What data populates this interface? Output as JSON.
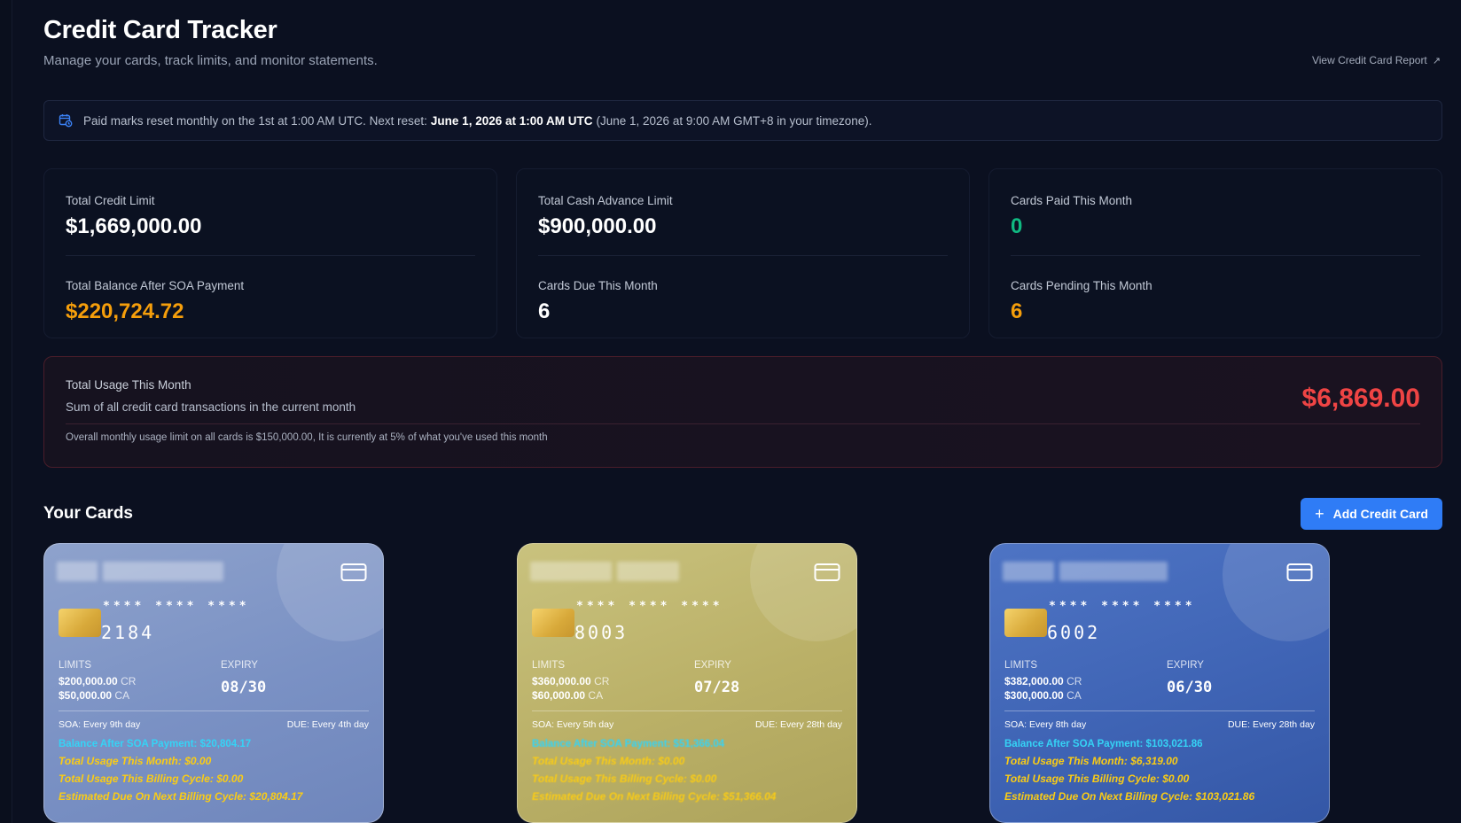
{
  "header": {
    "title": "Credit Card Tracker",
    "subtitle": "Manage your cards, track limits, and monitor statements.",
    "report_link": "View Credit Card Report"
  },
  "notice": {
    "text_before": "Paid marks reset monthly on the 1st at 1:00 AM UTC. Next reset:",
    "next_reset": "June 1, 2026 at 1:00 AM UTC",
    "text_after": "(June 1, 2026 at 9:00 AM GMT+8 in your timezone)."
  },
  "stats": [
    {
      "top_label": "Total Credit Limit",
      "top_value": "$1,669,000.00",
      "bottom_label": "Total Balance After SOA Payment",
      "bottom_value": "$220,724.72"
    },
    {
      "top_label": "Total Cash Advance Limit",
      "top_value": "$900,000.00",
      "bottom_label": "Cards Due This Month",
      "bottom_value": "6"
    },
    {
      "top_label": "Cards Paid This Month",
      "top_value": "0",
      "bottom_label": "Cards Pending This Month",
      "bottom_value": "6"
    }
  ],
  "usage": {
    "title": "Total Usage This Month",
    "description": "Sum of all credit card transactions in the current month",
    "amount": "$6,869.00",
    "note": "Overall monthly usage limit on all cards is $150,000.00, It is currently at 5% of what you've used this month"
  },
  "cards_section": {
    "title": "Your Cards",
    "add_button": "Add Credit Card"
  },
  "colors": {
    "accent": "#2f7cf6",
    "orange": "#f59e0b",
    "green": "#10b981",
    "red": "#ef4444",
    "cyan": "#35d3f5",
    "yellow": "#facc15"
  },
  "cards": [
    {
      "masked": "**** **** ****",
      "last4": "2184",
      "limits_label": "LIMITS",
      "expiry_label": "EXPIRY",
      "credit_limit": "$200,000.00",
      "cash_limit": "$50,000.00",
      "cr_unit": "CR",
      "ca_unit": "CA",
      "expiry": "08/30",
      "soa": "SOA: Every 9th day",
      "due": "DUE: Every 4th day",
      "balance_after_soa": "Balance After SOA Payment: $20,804.17",
      "usage_month": "Total Usage This Month: $0.00",
      "usage_cycle": "Total Usage This Billing Cycle: $0.00",
      "estimated_due": "Estimated Due On Next Billing Cycle: $20,804.17"
    },
    {
      "masked": "**** **** ****",
      "last4": "8003",
      "limits_label": "LIMITS",
      "expiry_label": "EXPIRY",
      "credit_limit": "$360,000.00",
      "cash_limit": "$60,000.00",
      "cr_unit": "CR",
      "ca_unit": "CA",
      "expiry": "07/28",
      "soa": "SOA: Every 5th day",
      "due": "DUE: Every 28th day",
      "balance_after_soa": "Balance After SOA Payment: $51,366.04",
      "usage_month": "Total Usage This Month: $0.00",
      "usage_cycle": "Total Usage This Billing Cycle: $0.00",
      "estimated_due": "Estimated Due On Next Billing Cycle: $51,366.04"
    },
    {
      "masked": "**** **** ****",
      "last4": "6002",
      "limits_label": "LIMITS",
      "expiry_label": "EXPIRY",
      "credit_limit": "$382,000.00",
      "cash_limit": "$300,000.00",
      "cr_unit": "CR",
      "ca_unit": "CA",
      "expiry": "06/30",
      "soa": "SOA: Every 8th day",
      "due": "DUE: Every 28th day",
      "balance_after_soa": "Balance After SOA Payment: $103,021.86",
      "usage_month": "Total Usage This Month: $6,319.00",
      "usage_cycle": "Total Usage This Billing Cycle: $0.00",
      "estimated_due": "Estimated Due On Next Billing Cycle: $103,021.86"
    }
  ]
}
